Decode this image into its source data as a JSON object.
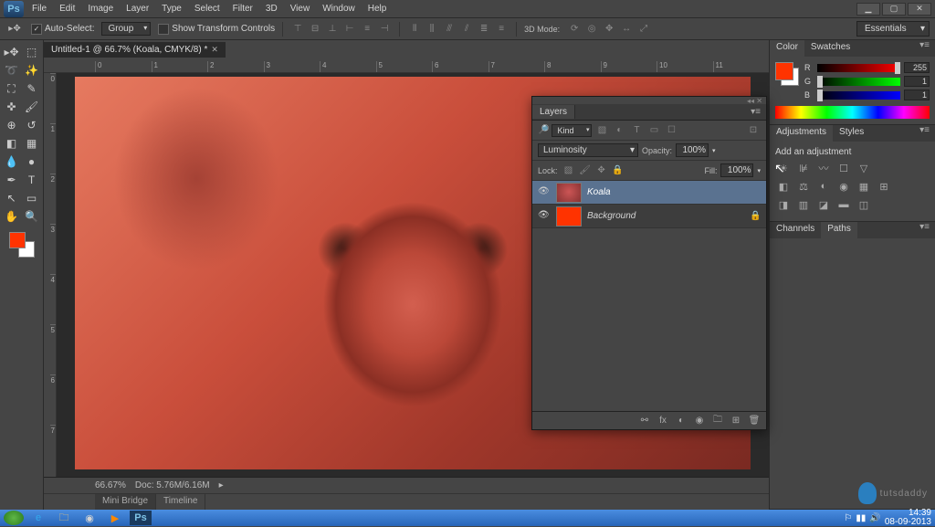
{
  "menubar": [
    "File",
    "Edit",
    "Image",
    "Layer",
    "Type",
    "Select",
    "Filter",
    "3D",
    "View",
    "Window",
    "Help"
  ],
  "options": {
    "autoselect": "Auto-Select:",
    "group": "Group",
    "showtransform": "Show Transform Controls",
    "mode3d": "3D Mode:"
  },
  "workspace": "Essentials",
  "doc": {
    "tab": "Untitled-1 @ 66.7% (Koala, CMYK/8) *",
    "zoom": "66.67%",
    "docinfo": "Doc: 5.76M/6.16M"
  },
  "layers_panel": {
    "tab": "Layers",
    "filter": "Kind",
    "blend": "Luminosity",
    "opacity_lbl": "Opacity:",
    "opacity": "100%",
    "lock_lbl": "Lock:",
    "fill_lbl": "Fill:",
    "fill": "100%",
    "rows": [
      {
        "name": "Koala",
        "sel": true,
        "thumb": "koala"
      },
      {
        "name": "Background",
        "sel": false,
        "thumb": "red",
        "locked": true
      }
    ]
  },
  "right": {
    "color_tab": "Color",
    "swatches_tab": "Swatches",
    "r": "255",
    "g": "1",
    "b": "1",
    "adj_tab": "Adjustments",
    "styles_tab": "Styles",
    "adj_title": "Add an adjustment",
    "channels_tab": "Channels",
    "paths_tab": "Paths"
  },
  "bottom_tabs": {
    "mini": "Mini Bridge",
    "timeline": "Timeline"
  },
  "watermark": "tutsdaddy",
  "tray": {
    "time": "14:39",
    "date": "08-09-2013"
  }
}
